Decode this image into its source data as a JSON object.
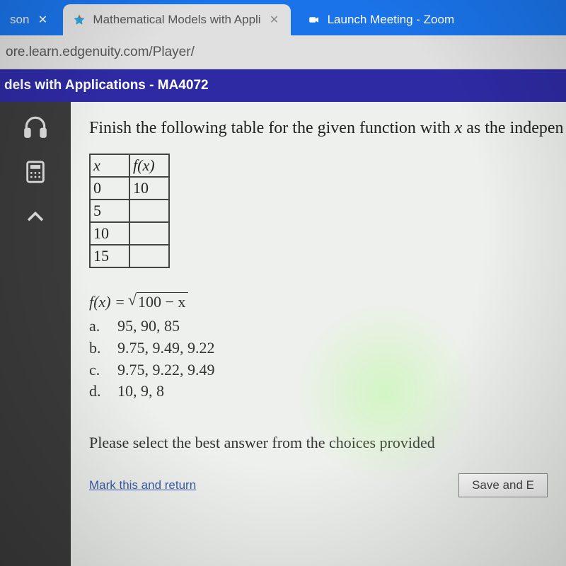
{
  "tabs": {
    "left": {
      "title_fragment": "son"
    },
    "active": {
      "title": "Mathematical Models with Appli"
    },
    "right": {
      "title": "Launch Meeting - Zoom"
    }
  },
  "address_bar": {
    "url": "ore.learn.edgenuity.com/Player/"
  },
  "course_header": {
    "title_fragment": "dels with Applications - MA4072"
  },
  "sidebar": {
    "icons": [
      "headphones-icon",
      "calculator-icon",
      "collapse-up-icon"
    ]
  },
  "question": {
    "prompt_prefix": "Finish the following table for the given function with ",
    "prompt_var": "x",
    "prompt_suffix": " as the indepen",
    "table": {
      "headers": {
        "col1": "x",
        "col2": "f(x)"
      },
      "rows": [
        {
          "x": "0",
          "fx": "10"
        },
        {
          "x": "5",
          "fx": ""
        },
        {
          "x": "10",
          "fx": ""
        },
        {
          "x": "15",
          "fx": ""
        }
      ]
    },
    "function": {
      "lhs": "f(x) = ",
      "radicand": "100 − x"
    },
    "options": [
      {
        "label": "a.",
        "text": "95, 90, 85"
      },
      {
        "label": "b.",
        "text": "9.75, 9.49, 9.22"
      },
      {
        "label": "c.",
        "text": "9.75, 9.22, 9.49"
      },
      {
        "label": "d.",
        "text": "10, 9, 8"
      }
    ],
    "select_prompt": "Please select the best answer from the choices provided"
  },
  "footer": {
    "mark_return": "Mark this and return",
    "save_button": "Save and E"
  }
}
